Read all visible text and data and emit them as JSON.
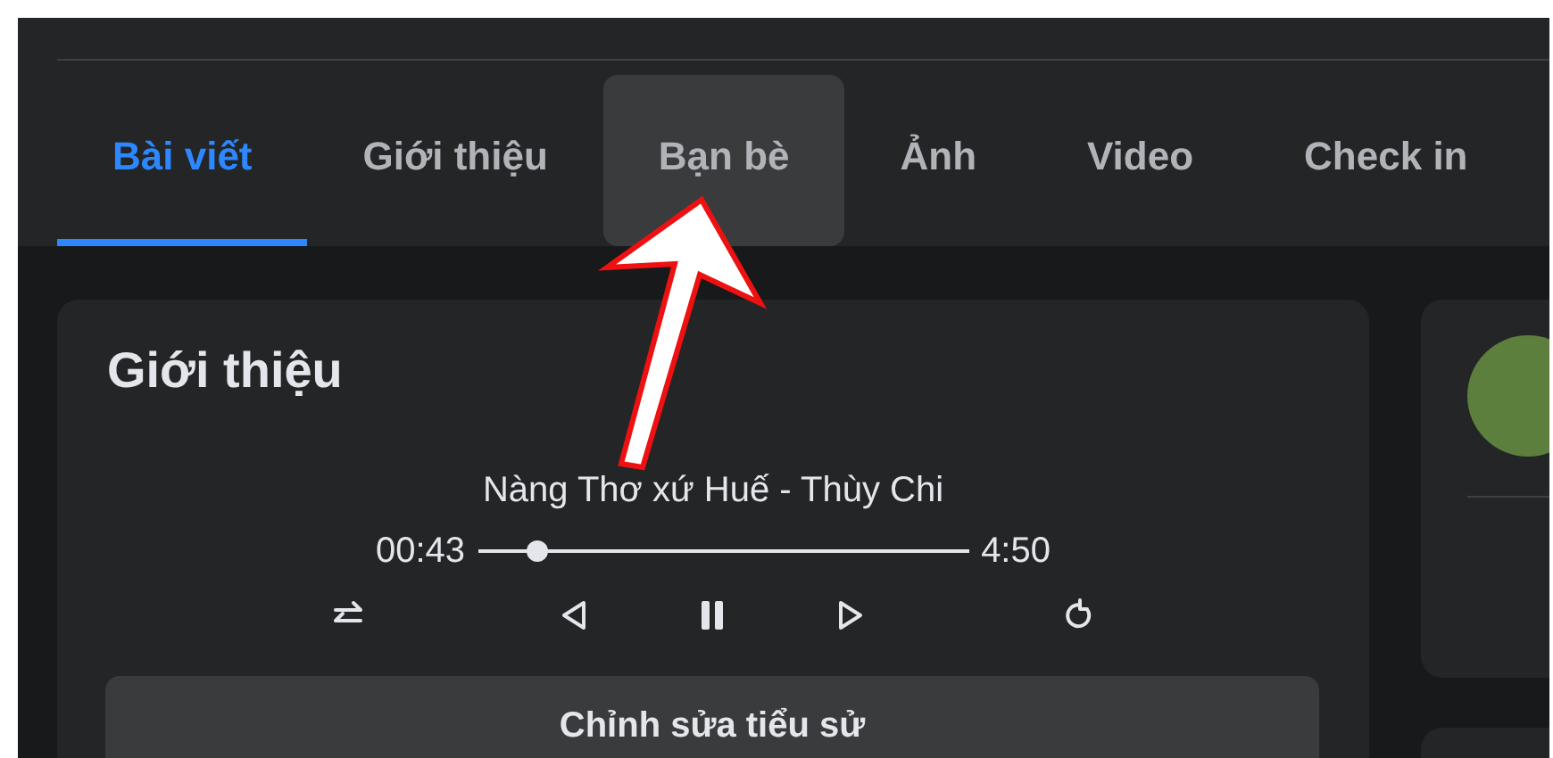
{
  "tabs": [
    {
      "label": "Bài viết",
      "selected": true,
      "hovered": false
    },
    {
      "label": "Giới thiệu",
      "selected": false,
      "hovered": false
    },
    {
      "label": "Bạn bè",
      "selected": false,
      "hovered": true
    },
    {
      "label": "Ảnh",
      "selected": false,
      "hovered": false
    },
    {
      "label": "Video",
      "selected": false,
      "hovered": false
    },
    {
      "label": "Check in",
      "selected": false,
      "hovered": false
    }
  ],
  "intro": {
    "title": "Giới thiệu",
    "player": {
      "track": "Nàng Thơ xứ Huế - Thùy Chi",
      "elapsed": "00:43",
      "duration": "4:50",
      "level": 0.12,
      "playing": true
    },
    "edit_button": "Chỉnh sửa tiểu sử"
  },
  "annotation": {
    "kind": "arrow"
  }
}
